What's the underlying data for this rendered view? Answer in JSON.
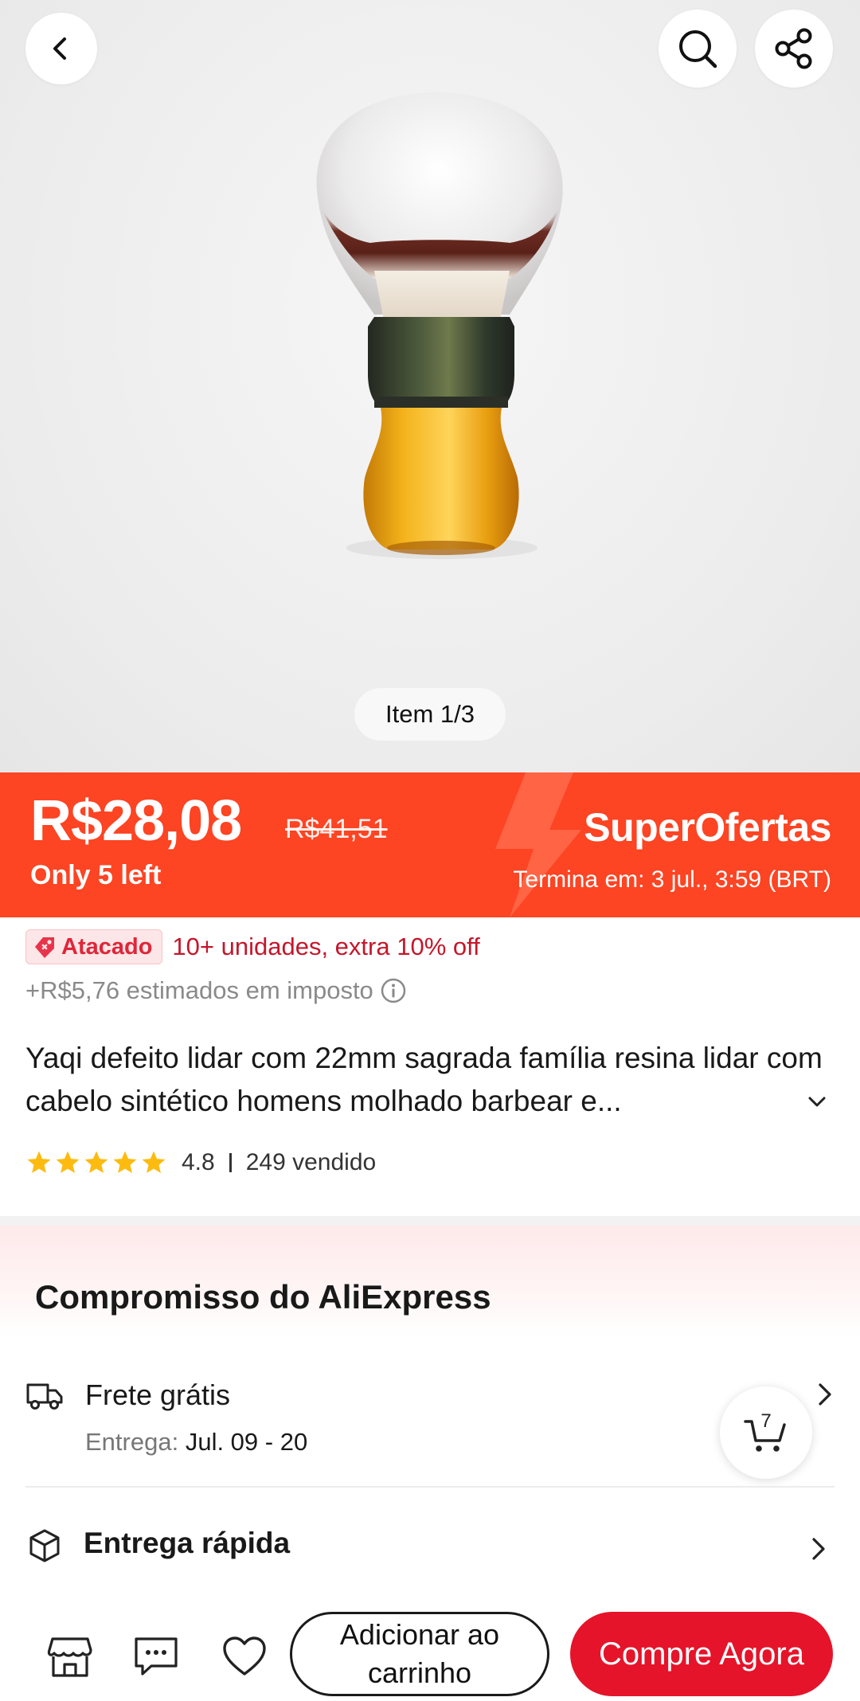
{
  "hero": {
    "image_counter": "Item 1/3"
  },
  "price_banner": {
    "price": "R$28,08",
    "original_price": "R$41,51",
    "stock": "Only 5 left",
    "campaign": "SuperOfertas",
    "ends": "Termina em: 3 jul., 3:59 (BRT)",
    "background_color": "#fd4423"
  },
  "wholesale": {
    "tag": "Atacado",
    "text": "10+ unidades, extra 10% off"
  },
  "tax": {
    "text": "+R$5,76 estimados em imposto"
  },
  "product": {
    "title": "Yaqi defeito lidar com 22mm sagrada família resina lidar com cabelo sintético homens molhado barbear e...",
    "rating": "4.8",
    "rating_stars": 5,
    "sold": "249 vendido"
  },
  "commitment": {
    "title": "Compromisso do AliExpress",
    "shipping_title": "Frete grátis",
    "delivery_label": "Entrega:",
    "delivery_dates": "Jul. 09 - 20",
    "fast_delivery": "Entrega rápida"
  },
  "cart_fab": {
    "count": "7"
  },
  "bottom_bar": {
    "add_to_cart": "Adicionar ao carrinho",
    "buy_now": "Compre Agora",
    "accent_color": "#e5142a"
  },
  "icons": [
    "back-icon",
    "search-icon",
    "share-icon",
    "tag-icon",
    "info-icon",
    "chevron-down-icon",
    "star-icon",
    "truck-icon",
    "chevron-right-icon",
    "cart-icon",
    "box-icon",
    "store-icon",
    "chat-icon",
    "heart-icon"
  ]
}
